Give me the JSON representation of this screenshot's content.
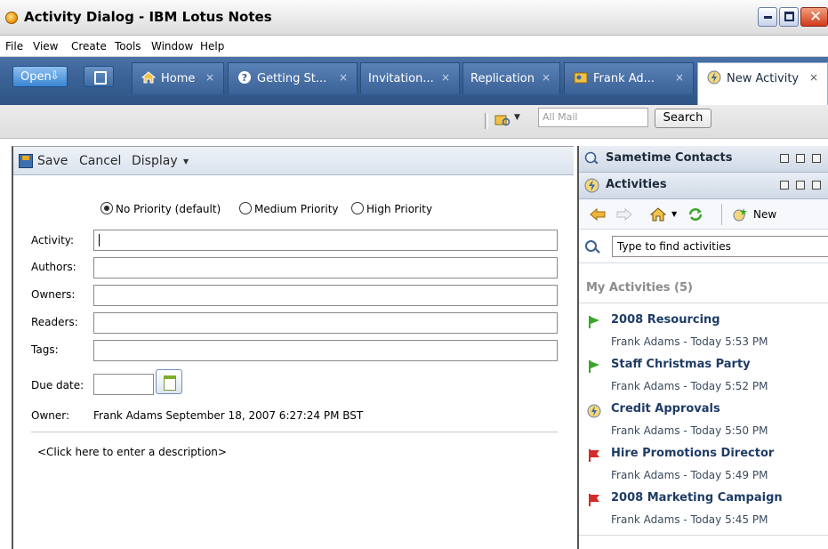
{
  "window": {
    "title": "Activity Dialog - IBM Lotus Notes"
  },
  "menu": [
    "File",
    "View",
    "Create",
    "Tools",
    "Window",
    "Help"
  ],
  "toolbar": {
    "open_label": "Open",
    "tabs": [
      {
        "label": "Home",
        "icon": "home-icon"
      },
      {
        "label": "Getting St...",
        "icon": "help-icon"
      },
      {
        "label": "Invitation...",
        "icon": ""
      },
      {
        "label": "Replication",
        "icon": ""
      },
      {
        "label": "Frank Ad...",
        "icon": "contact-icon"
      },
      {
        "label": "New Activity",
        "icon": "activity-icon"
      }
    ],
    "close_glyph": "×"
  },
  "search": {
    "placeholder": "All Mail",
    "button_label": "Search"
  },
  "form": {
    "actions": {
      "save": "Save",
      "cancel": "Cancel",
      "display": "Display"
    },
    "priority": {
      "options": [
        "No Priority (default)",
        "Medium Priority",
        "High Priority"
      ],
      "selected": "No Priority (default)"
    },
    "fields": {
      "activity": "Activity:",
      "authors": "Authors:",
      "owners": "Owners:",
      "readers": "Readers:",
      "tags": "Tags:",
      "due_date": "Due date:"
    },
    "owner_label": "Owner:",
    "owner_value": "Frank Adams September 18, 2007 6:27:24 PM BST",
    "description": "<Click here to enter a description>"
  },
  "sidebar": {
    "sametime_title": "Sametime Contacts",
    "activities_title": "Activities",
    "new_label": "New",
    "find_value": "Type to find activities",
    "my_activities": "My Activities (5)",
    "items": [
      {
        "title": "2008 Resourcing",
        "meta": "Frank Adams - Today 5:53 PM",
        "icon": "green-flag-icon"
      },
      {
        "title": "Staff Christmas Party",
        "meta": "Frank Adams - Today 5:52 PM",
        "icon": "green-flag-icon"
      },
      {
        "title": "Credit Approvals",
        "meta": "Frank Adams - Today 5:50 PM",
        "icon": "activity-icon"
      },
      {
        "title": "Hire Promotions Director",
        "meta": "Frank Adams - Today 5:49 PM",
        "icon": "red-flag-icon"
      },
      {
        "title": "2008 Marketing Campaign",
        "meta": "Frank Adams - Today 5:45 PM",
        "icon": "red-flag-icon"
      }
    ]
  },
  "colors": {
    "tabbar": "#3c6398",
    "accent": "#1f3c66",
    "flag_green": "#3aa62a",
    "flag_red": "#d52a2a"
  }
}
